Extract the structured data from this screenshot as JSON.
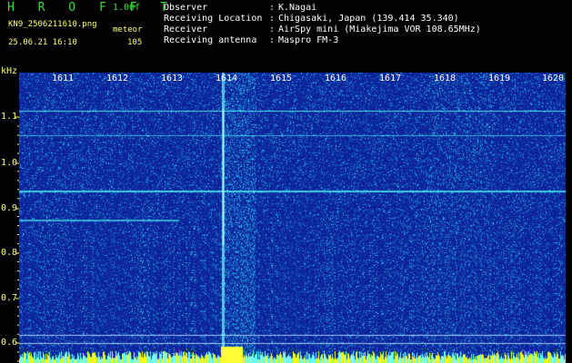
{
  "header": {
    "logo": "HROFFT",
    "version": "1.00f",
    "filename": "KN9_2506211610.png",
    "timestamp": "25.06.21 16:10",
    "meteor_label": "meteor",
    "meteor_count": "105"
  },
  "meta": [
    {
      "label": "Observer",
      "value": "K.Nagai"
    },
    {
      "label": "Receiving Location",
      "value": "Chigasaki, Japan (139.414 35.340)"
    },
    {
      "label": "Receiver",
      "value": "AirSpy mini (Miakejima VOR 108.65MHz)"
    },
    {
      "label": "Receiving antenna",
      "value": "Maspro FM-3"
    }
  ],
  "spectrogram": {
    "y_unit": "kHz",
    "y_ticks": [
      "1.1",
      "1.0",
      "0.9",
      "0.8",
      "0.7",
      "0.6"
    ],
    "y_range": [
      0.58,
      1.22
    ],
    "time_ticks": [
      "1611",
      "1612",
      "1613",
      "1614",
      "1615",
      "1616",
      "1617",
      "1618",
      "1619",
      "1620"
    ],
    "colors": {
      "background": "#0a1aa0",
      "signal": "#33ffff",
      "burst": "#ffff00"
    }
  }
}
